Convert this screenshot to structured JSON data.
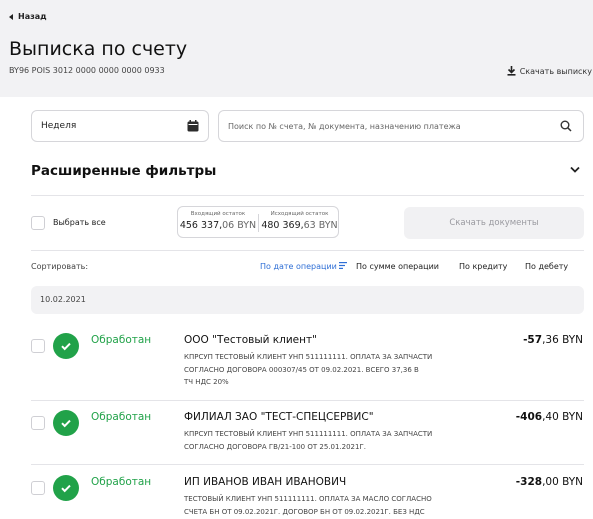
{
  "nav": {
    "back_label": "Назад"
  },
  "header": {
    "title": "Выписка по счету",
    "account": "BY96 POIS 3012 0000 0000 0000 0933",
    "download_statement_label": "Скачать выписку"
  },
  "filters": {
    "period_value": "Неделя",
    "search_placeholder": "Поиск по № счета, № документа, назначению платежа",
    "advanced_label": "Расширенные фильтры"
  },
  "selection": {
    "select_all_label": "Выбрать все",
    "incoming_label": "Входящий остаток",
    "incoming_int": "456 337,",
    "incoming_dec": "06 BYN",
    "outgoing_label": "Исходящий остаток",
    "outgoing_int": "480 369,",
    "outgoing_dec": "63 BYN",
    "download_docs_label": "Скачать документы"
  },
  "sort": {
    "label": "Сортировать:",
    "options": [
      "По дате операции",
      "По сумме операции",
      "По кредиту",
      "По дебету"
    ],
    "active": "По дате операции"
  },
  "date_group": "10.02.2021",
  "operations": [
    {
      "status": "Обработан",
      "payee": "ООО \"Тестовый клиент\"",
      "description_lines": [
        "КПРСУП Тестовый клиент УНП 511111111. ОПЛАТА ЗА ЗАПЧАСТИ",
        "СОГЛАСНО ДОГОВОРА 000307/45 ОТ 09.02.2021. ВСЕГО 37,36 В",
        "ТЧ НДС 20%"
      ],
      "amount_int": "-57",
      "amount_rest": ",36 BYN"
    },
    {
      "status": "Обработан",
      "payee": "ФИЛИАЛ ЗАО \"ТЕСТ-СПЕЦСЕРВИС\"",
      "description_lines": [
        "КПРСУП Тестовый клиент УНП 511111111. ОПЛАТА ЗА ЗАПЧАСТИ",
        "СОГЛАСНО ДОГОВОРА ГВ/21-100 ОТ 25.01.2021Г."
      ],
      "amount_int": "-406",
      "amount_rest": ",40 BYN"
    },
    {
      "status": "Обработан",
      "payee": "ИП ИВАНОВ ИВАН ИВАНОВИЧ",
      "description_lines": [
        "Тестовый клиент УНП 511111111. ОПЛАТА ЗА МАСЛО СОГЛАСНО",
        "СЧЕТА БН ОТ 09.02.2021Г. ДОГОВОР БН ОТ 09.02.2021Г. БЕЗ НДС"
      ],
      "amount_int": "-328",
      "amount_rest": ",00 BYN"
    }
  ],
  "colors": {
    "status_green": "#21a249",
    "accent_blue": "#2f6fd6",
    "panel_gray": "#f2f2f4"
  }
}
